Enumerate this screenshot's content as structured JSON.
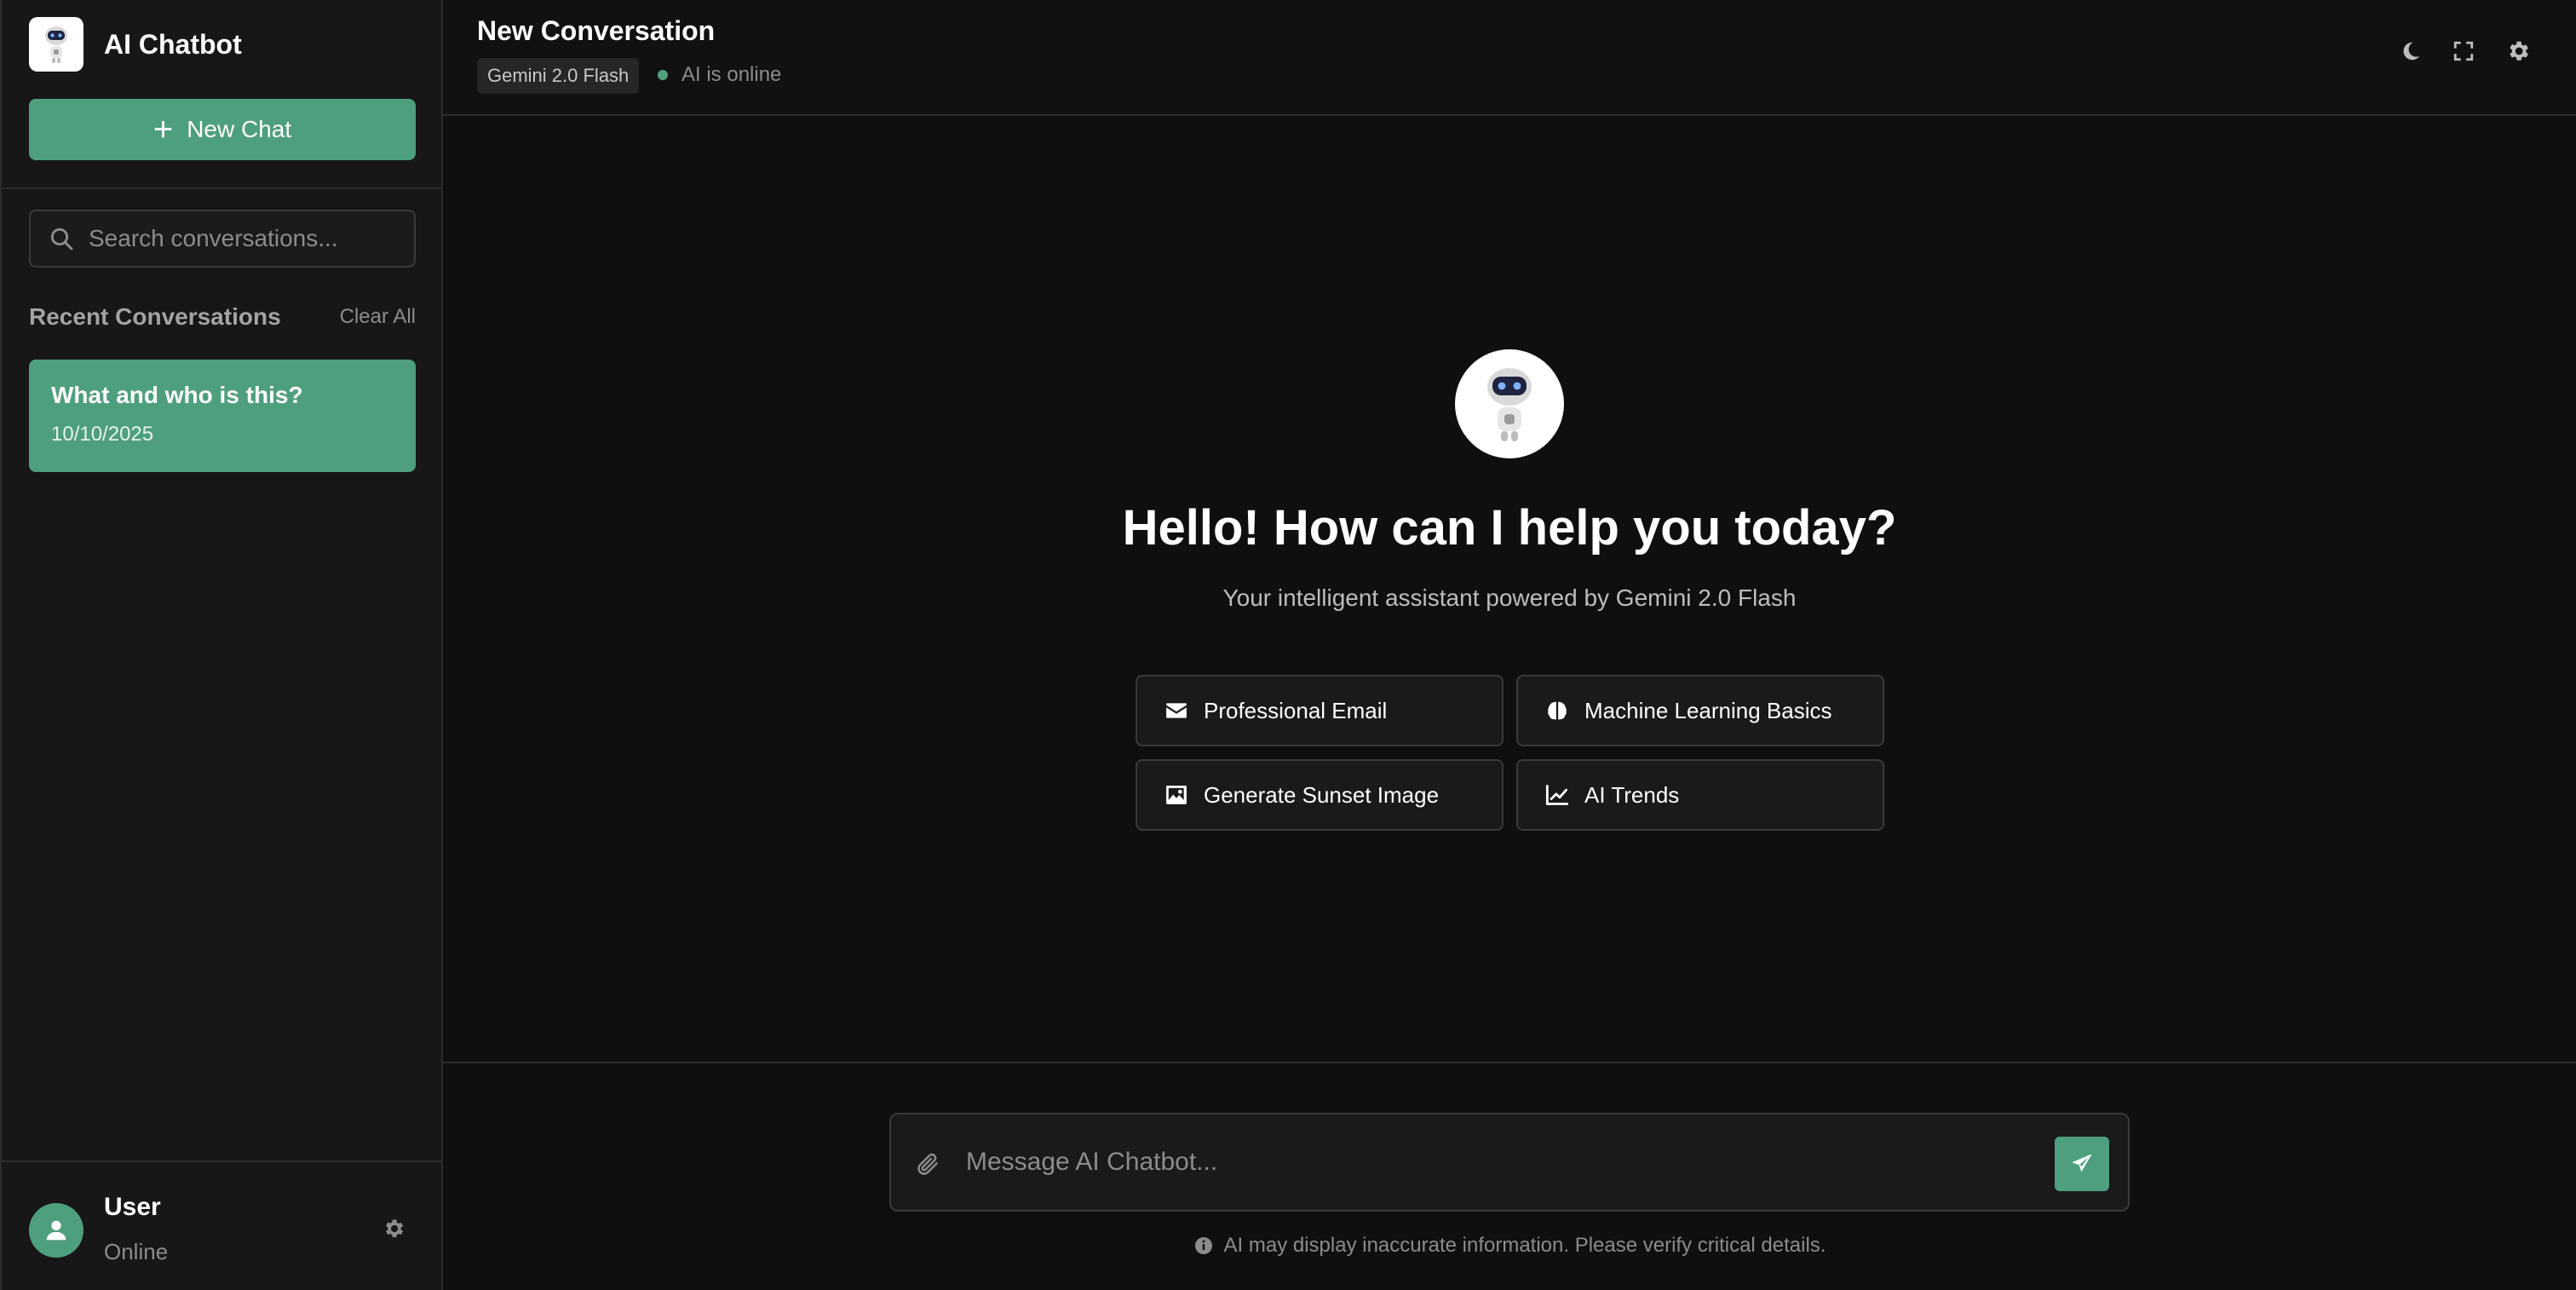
{
  "app": {
    "title": "AI Chatbot",
    "logo_icon": "robot-icon"
  },
  "sidebar": {
    "new_chat_label": "New Chat",
    "search_placeholder": "Search conversations...",
    "recent_title": "Recent Conversations",
    "clear_all_label": "Clear All",
    "conversations": [
      {
        "title": "What and who is this?",
        "date": "10/10/2025"
      }
    ],
    "user": {
      "name": "User",
      "status": "Online"
    }
  },
  "header": {
    "title": "New Conversation",
    "model": "Gemini 2.0 Flash",
    "status": "AI is online",
    "icons": [
      "moon-icon",
      "fullscreen-icon",
      "gear-icon"
    ]
  },
  "welcome": {
    "title": "Hello! How can I help you today?",
    "subtitle": "Your intelligent assistant powered by Gemini 2.0 Flash",
    "suggestions": [
      {
        "label": "Professional Email",
        "icon": "envelope-icon"
      },
      {
        "label": "Machine Learning Basics",
        "icon": "brain-icon"
      },
      {
        "label": "Generate Sunset Image",
        "icon": "image-icon"
      },
      {
        "label": "AI Trends",
        "icon": "chart-line-icon"
      }
    ]
  },
  "composer": {
    "placeholder": "Message AI Chatbot...",
    "value": "",
    "disclaimer": "AI may display inaccurate information. Please verify critical details."
  },
  "colors": {
    "accent": "#4e9f7d",
    "background": "#0f0f0f",
    "sidebar": "#171717"
  }
}
